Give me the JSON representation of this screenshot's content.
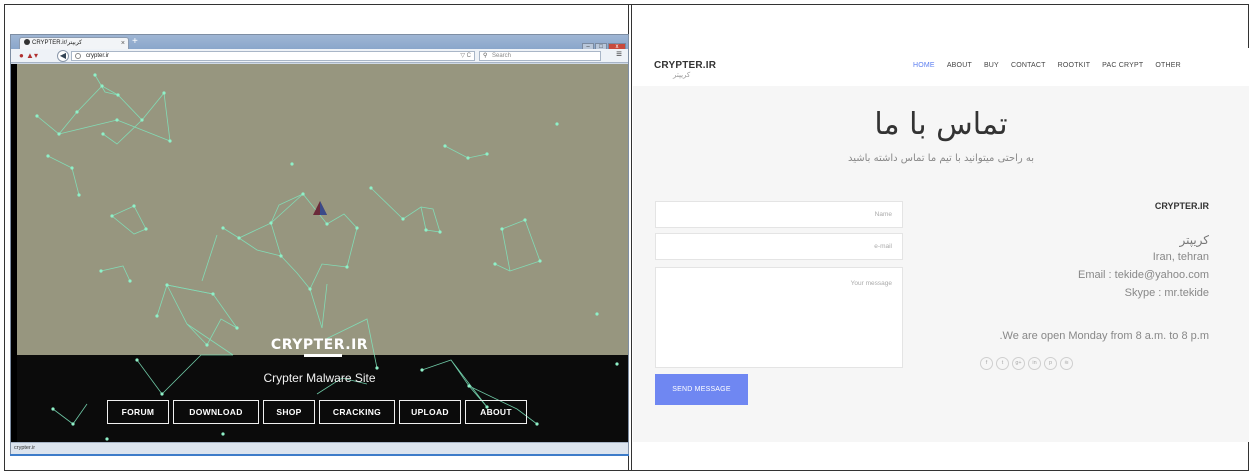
{
  "browser": {
    "tab_title": "CRYPTER.ir/کریپتر",
    "tab_close": "×",
    "new_tab": "+",
    "back": "◀",
    "url": "crypter.ir",
    "reload": "▽ C",
    "search_placeholder": "Search",
    "menu": "≡",
    "status_url": "crypter.ir",
    "win_min": "–",
    "win_max": "□",
    "win_close": "x"
  },
  "landing": {
    "logo": "CRYPTER.IR",
    "tagline": "Crypter Malware Site",
    "nav": [
      "FORUM",
      "DOWNLOAD",
      "SHOP",
      "CRACKING",
      "UPLOAD",
      "ABOUT"
    ]
  },
  "contact_page": {
    "brand": "CRYPTER.IR",
    "brand_sub": "کریپتر",
    "nav": [
      "HOME",
      "ABOUT",
      "BUY",
      "CONTACT",
      "ROOTKIT",
      "PAC CRYPT",
      "OTHER"
    ],
    "active_nav": "HOME",
    "title": "تماس با ما",
    "subtitle": "به راحتی میتوانید با تیم ما تماس داشته باشید",
    "form": {
      "name_placeholder": "Name",
      "email_placeholder": "e-mail",
      "message_placeholder": "Your message",
      "send_label": "SEND MESSAGE"
    },
    "info": {
      "title": "CRYPTER.IR",
      "name_fa": "کریپتر",
      "location": "Iran, tehran",
      "email": "Email : tekide@yahoo.com",
      "skype": "Skype : mr.tekide",
      "hours": ".We are open Monday from 8 a.m. to 8 p.m"
    },
    "socials": [
      {
        "icon": "facebook-icon",
        "glyph": "f"
      },
      {
        "icon": "twitter-icon",
        "glyph": "t"
      },
      {
        "icon": "google-plus-icon",
        "glyph": "g+"
      },
      {
        "icon": "linkedin-icon",
        "glyph": "in"
      },
      {
        "icon": "pinterest-icon",
        "glyph": "p"
      },
      {
        "icon": "rss-icon",
        "glyph": "≋"
      }
    ]
  },
  "colors": {
    "accent": "#6f87f2",
    "canvas": "#97967f",
    "network_line": "#7fe8bf"
  }
}
